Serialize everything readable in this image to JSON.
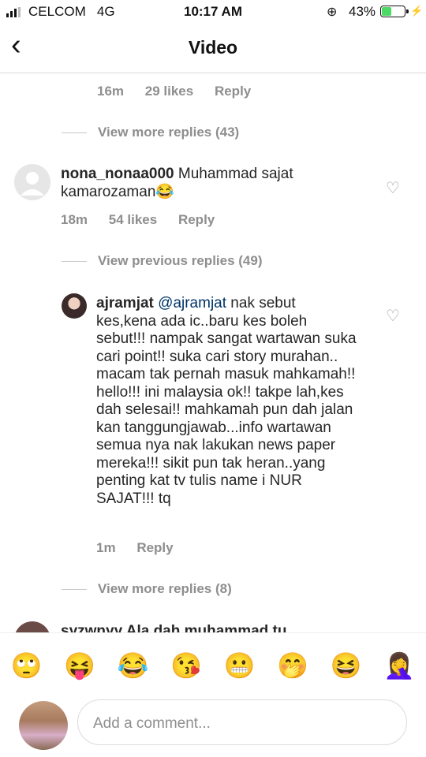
{
  "status": {
    "carrier": "CELCOM",
    "network": "4G",
    "time": "10:17 AM",
    "battery": "43%",
    "battery_level": 0.43
  },
  "nav": {
    "title": "Video"
  },
  "top_reply": {
    "time": "16m",
    "likes": "29 likes",
    "reply": "Reply"
  },
  "view_more_1": "View more replies (43)",
  "comment1": {
    "username": "nona_nonaa000",
    "text": " Muhammad sajat kamarozaman😂",
    "time": "18m",
    "likes": "54 likes",
    "reply": "Reply"
  },
  "view_previous": "View previous replies (49)",
  "comment2": {
    "username": "ajramjat",
    "mention": " @ajramjat",
    "text": "  nak sebut kes,kena ada ic..baru kes boleh sebut!!! nampak sangat wartawan suka cari point!! suka cari story murahan.. macam tak pernah masuk mahkamah!! hello!!! ini malaysia ok!! takpe lah,kes dah selesai!! mahkamah pun dah jalan kan tanggungjawab...info wartawan semua nya nak lakukan news paper mereka!!! sikit pun tak heran..yang penting kat tv tulis name i NUR SAJAT!!! tq",
    "time": "1m",
    "reply": "Reply"
  },
  "view_more_2": "View more replies (8)",
  "partial_comment": "syzwnyy     Ala dah muhammad tu",
  "emojis": [
    "🙄",
    "😝",
    "😂",
    "😘",
    "😬",
    "🤭",
    "😆",
    "🤦‍♀️"
  ],
  "comment_input": {
    "placeholder": "Add a comment..."
  },
  "icons": {
    "back": "chevron-left-icon",
    "heart": "heart-outline-icon"
  }
}
